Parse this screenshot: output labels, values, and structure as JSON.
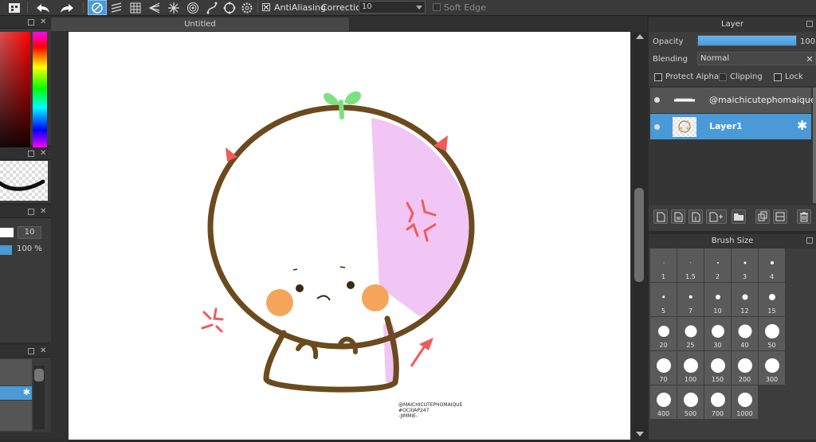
{
  "toolbar": {
    "antialiasing_label": "AntiAliasing",
    "correction_label": "Correction",
    "correction_value": "10",
    "soft_edge_label": "Soft Edge"
  },
  "left": {
    "brush_size_value": "10",
    "opacity_value": "100 %"
  },
  "document": {
    "tab_title": "Untitled"
  },
  "artwork": {
    "signature_lines": [
      "@MAICHICUTEPHOMAIQUE",
      "#OCIIIAP247",
      "-JIMMIE-"
    ]
  },
  "layer_panel": {
    "title": "Layer",
    "opacity_label": "Opacity",
    "opacity_value": "100",
    "opacity_fraction": 1.0,
    "blending_label": "Blending",
    "blending_value": "Normal",
    "protect_alpha_label": "Protect Alpha",
    "clipping_label": "Clipping",
    "lock_label": "Lock",
    "layers": [
      {
        "name": "@maichicutephomaique",
        "selected": false
      },
      {
        "name": "Layer1",
        "selected": true
      }
    ]
  },
  "brush_panel": {
    "title": "Brush Size",
    "sizes": [
      "1",
      "1.5",
      "2",
      "3",
      "4",
      "5",
      "7",
      "10",
      "12",
      "15",
      "20",
      "25",
      "30",
      "40",
      "50",
      "70",
      "100",
      "150",
      "200",
      "300",
      "400",
      "500",
      "700",
      "1000"
    ]
  },
  "colors": {
    "accent": "#4a9ad8",
    "outline": "#6b4a1e",
    "blush": "#f5a55a",
    "pink": "#f2c6f4",
    "sprout": "#7de07f",
    "horn": "#ef5b5b"
  }
}
